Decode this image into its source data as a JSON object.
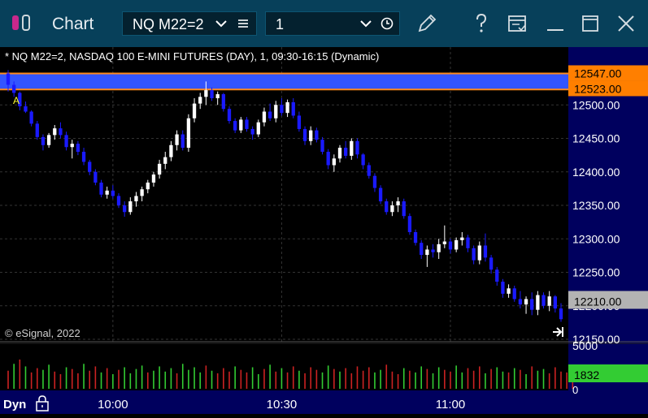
{
  "window": {
    "title": "Chart",
    "symbol": "NQ M22=2",
    "interval": "1",
    "icons": [
      "app-logo-icon",
      "chevron-down-icon",
      "menu-icon",
      "chevron-down-icon",
      "clock-icon",
      "pencil-icon",
      "help-icon",
      "template-icon",
      "minimize-icon",
      "maximize-icon",
      "close-icon"
    ]
  },
  "chart_header": "* NQ M22=2, NASDAQ 100 E-MINI FUTURES (DAY), 1, 09:30-16:15 (Dynamic)",
  "watermark": "© eSignal, 2022",
  "marker_label": "A",
  "bottom": {
    "mode": "Dyn",
    "lock_icon": "lock-icon",
    "goto_icon": "go-to-end-icon"
  },
  "colors": {
    "up": "#ffffff",
    "down": "#1a1aff",
    "band": "#3355ff",
    "band_border": "#ff8a1a",
    "price_tag": "#ff7f00",
    "last_tag": "#b3b3b3",
    "volume_tag": "#33cc33",
    "axis_bg": "#00005e"
  },
  "chart_data": {
    "type": "candlestick",
    "price_axis": {
      "ticks": [
        "12500.00",
        "12450.00",
        "12400.00",
        "12350.00",
        "12300.00",
        "12250.00",
        "12200.00",
        "12150.00"
      ],
      "ylim": [
        12150,
        12550
      ]
    },
    "time_axis": {
      "ticks": [
        "10:00",
        "10:30",
        "11:00"
      ]
    },
    "band": {
      "from": 12523,
      "to": 12547,
      "labels": [
        "12547.00",
        "12523.00"
      ]
    },
    "last_price_label": "12210.00",
    "volume_axis": {
      "max_label": "5000",
      "min_label": "0",
      "last_label": "1832",
      "ylim": [
        0,
        5000
      ]
    },
    "candles": [
      {
        "o": 12547,
        "h": 12552,
        "l": 12520,
        "c": 12530
      },
      {
        "o": 12530,
        "h": 12535,
        "l": 12512,
        "c": 12518
      },
      {
        "o": 12518,
        "h": 12520,
        "l": 12492,
        "c": 12498
      },
      {
        "o": 12498,
        "h": 12505,
        "l": 12488,
        "c": 12490
      },
      {
        "o": 12490,
        "h": 12492,
        "l": 12468,
        "c": 12472
      },
      {
        "o": 12472,
        "h": 12476,
        "l": 12448,
        "c": 12452
      },
      {
        "o": 12452,
        "h": 12456,
        "l": 12432,
        "c": 12440
      },
      {
        "o": 12440,
        "h": 12458,
        "l": 12436,
        "c": 12455
      },
      {
        "o": 12455,
        "h": 12470,
        "l": 12448,
        "c": 12465
      },
      {
        "o": 12465,
        "h": 12474,
        "l": 12450,
        "c": 12455
      },
      {
        "o": 12455,
        "h": 12460,
        "l": 12432,
        "c": 12437
      },
      {
        "o": 12437,
        "h": 12448,
        "l": 12420,
        "c": 12442
      },
      {
        "o": 12442,
        "h": 12446,
        "l": 12425,
        "c": 12430
      },
      {
        "o": 12430,
        "h": 12436,
        "l": 12410,
        "c": 12415
      },
      {
        "o": 12415,
        "h": 12418,
        "l": 12395,
        "c": 12400
      },
      {
        "o": 12400,
        "h": 12404,
        "l": 12380,
        "c": 12384
      },
      {
        "o": 12384,
        "h": 12388,
        "l": 12362,
        "c": 12366
      },
      {
        "o": 12366,
        "h": 12378,
        "l": 12360,
        "c": 12372
      },
      {
        "o": 12372,
        "h": 12380,
        "l": 12360,
        "c": 12364
      },
      {
        "o": 12364,
        "h": 12368,
        "l": 12346,
        "c": 12350
      },
      {
        "o": 12350,
        "h": 12356,
        "l": 12333,
        "c": 12340
      },
      {
        "o": 12340,
        "h": 12362,
        "l": 12336,
        "c": 12356
      },
      {
        "o": 12356,
        "h": 12370,
        "l": 12348,
        "c": 12364
      },
      {
        "o": 12364,
        "h": 12378,
        "l": 12356,
        "c": 12374
      },
      {
        "o": 12374,
        "h": 12388,
        "l": 12368,
        "c": 12384
      },
      {
        "o": 12384,
        "h": 12400,
        "l": 12378,
        "c": 12396
      },
      {
        "o": 12396,
        "h": 12418,
        "l": 12390,
        "c": 12412
      },
      {
        "o": 12412,
        "h": 12430,
        "l": 12404,
        "c": 12422
      },
      {
        "o": 12422,
        "h": 12446,
        "l": 12416,
        "c": 12440
      },
      {
        "o": 12440,
        "h": 12462,
        "l": 12432,
        "c": 12456
      },
      {
        "o": 12456,
        "h": 12462,
        "l": 12432,
        "c": 12436
      },
      {
        "o": 12436,
        "h": 12486,
        "l": 12430,
        "c": 12480
      },
      {
        "o": 12480,
        "h": 12510,
        "l": 12474,
        "c": 12502
      },
      {
        "o": 12502,
        "h": 12518,
        "l": 12494,
        "c": 12512
      },
      {
        "o": 12512,
        "h": 12535,
        "l": 12500,
        "c": 12522
      },
      {
        "o": 12522,
        "h": 12526,
        "l": 12506,
        "c": 12510
      },
      {
        "o": 12510,
        "h": 12520,
        "l": 12500,
        "c": 12516
      },
      {
        "o": 12516,
        "h": 12518,
        "l": 12490,
        "c": 12494
      },
      {
        "o": 12494,
        "h": 12498,
        "l": 12472,
        "c": 12476
      },
      {
        "o": 12476,
        "h": 12480,
        "l": 12458,
        "c": 12462
      },
      {
        "o": 12462,
        "h": 12482,
        "l": 12458,
        "c": 12478
      },
      {
        "o": 12478,
        "h": 12482,
        "l": 12460,
        "c": 12464
      },
      {
        "o": 12464,
        "h": 12468,
        "l": 12448,
        "c": 12456
      },
      {
        "o": 12456,
        "h": 12478,
        "l": 12452,
        "c": 12474
      },
      {
        "o": 12474,
        "h": 12496,
        "l": 12468,
        "c": 12490
      },
      {
        "o": 12490,
        "h": 12502,
        "l": 12476,
        "c": 12480
      },
      {
        "o": 12480,
        "h": 12506,
        "l": 12474,
        "c": 12500
      },
      {
        "o": 12500,
        "h": 12510,
        "l": 12484,
        "c": 12488
      },
      {
        "o": 12488,
        "h": 12508,
        "l": 12482,
        "c": 12504
      },
      {
        "o": 12504,
        "h": 12510,
        "l": 12480,
        "c": 12484
      },
      {
        "o": 12484,
        "h": 12490,
        "l": 12460,
        "c": 12464
      },
      {
        "o": 12464,
        "h": 12468,
        "l": 12440,
        "c": 12446
      },
      {
        "o": 12446,
        "h": 12468,
        "l": 12440,
        "c": 12462
      },
      {
        "o": 12462,
        "h": 12466,
        "l": 12444,
        "c": 12448
      },
      {
        "o": 12448,
        "h": 12452,
        "l": 12426,
        "c": 12430
      },
      {
        "o": 12430,
        "h": 12434,
        "l": 12404,
        "c": 12410
      },
      {
        "o": 12410,
        "h": 12426,
        "l": 12400,
        "c": 12420
      },
      {
        "o": 12420,
        "h": 12440,
        "l": 12414,
        "c": 12436
      },
      {
        "o": 12436,
        "h": 12446,
        "l": 12420,
        "c": 12424
      },
      {
        "o": 12424,
        "h": 12450,
        "l": 12418,
        "c": 12446
      },
      {
        "o": 12446,
        "h": 12450,
        "l": 12420,
        "c": 12426
      },
      {
        "o": 12426,
        "h": 12428,
        "l": 12404,
        "c": 12410
      },
      {
        "o": 12410,
        "h": 12414,
        "l": 12390,
        "c": 12394
      },
      {
        "o": 12394,
        "h": 12398,
        "l": 12370,
        "c": 12376
      },
      {
        "o": 12376,
        "h": 12380,
        "l": 12352,
        "c": 12356
      },
      {
        "o": 12356,
        "h": 12360,
        "l": 12336,
        "c": 12340
      },
      {
        "o": 12340,
        "h": 12356,
        "l": 12334,
        "c": 12350
      },
      {
        "o": 12350,
        "h": 12362,
        "l": 12340,
        "c": 12356
      },
      {
        "o": 12356,
        "h": 12360,
        "l": 12330,
        "c": 12334
      },
      {
        "o": 12334,
        "h": 12338,
        "l": 12306,
        "c": 12310
      },
      {
        "o": 12310,
        "h": 12314,
        "l": 12290,
        "c": 12294
      },
      {
        "o": 12294,
        "h": 12298,
        "l": 12270,
        "c": 12276
      },
      {
        "o": 12276,
        "h": 12290,
        "l": 12258,
        "c": 12284
      },
      {
        "o": 12284,
        "h": 12292,
        "l": 12272,
        "c": 12280
      },
      {
        "o": 12280,
        "h": 12300,
        "l": 12270,
        "c": 12292
      },
      {
        "o": 12292,
        "h": 12320,
        "l": 12286,
        "c": 12296
      },
      {
        "o": 12296,
        "h": 12300,
        "l": 12278,
        "c": 12284
      },
      {
        "o": 12284,
        "h": 12302,
        "l": 12280,
        "c": 12298
      },
      {
        "o": 12298,
        "h": 12310,
        "l": 12290,
        "c": 12302
      },
      {
        "o": 12302,
        "h": 12306,
        "l": 12280,
        "c": 12286
      },
      {
        "o": 12286,
        "h": 12290,
        "l": 12262,
        "c": 12268
      },
      {
        "o": 12268,
        "h": 12296,
        "l": 12262,
        "c": 12290
      },
      {
        "o": 12290,
        "h": 12308,
        "l": 12266,
        "c": 12272
      },
      {
        "o": 12272,
        "h": 12276,
        "l": 12248,
        "c": 12254
      },
      {
        "o": 12254,
        "h": 12258,
        "l": 12230,
        "c": 12236
      },
      {
        "o": 12236,
        "h": 12240,
        "l": 12212,
        "c": 12218
      },
      {
        "o": 12218,
        "h": 12232,
        "l": 12212,
        "c": 12226
      },
      {
        "o": 12226,
        "h": 12230,
        "l": 12206,
        "c": 12210
      },
      {
        "o": 12210,
        "h": 12222,
        "l": 12196,
        "c": 12202
      },
      {
        "o": 12202,
        "h": 12214,
        "l": 12188,
        "c": 12210
      },
      {
        "o": 12210,
        "h": 12220,
        "l": 12186,
        "c": 12194
      },
      {
        "o": 12194,
        "h": 12222,
        "l": 12186,
        "c": 12216
      },
      {
        "o": 12216,
        "h": 12220,
        "l": 12196,
        "c": 12200
      },
      {
        "o": 12200,
        "h": 12222,
        "l": 12192,
        "c": 12214
      },
      {
        "o": 12214,
        "h": 12216,
        "l": 12190,
        "c": 12196
      },
      {
        "o": 12196,
        "h": 12204,
        "l": 12176,
        "c": 12180
      }
    ],
    "volume": [
      2100,
      2900,
      3400,
      2600,
      1900,
      2400,
      2200,
      2800,
      2000,
      1700,
      2500,
      2300,
      1800,
      2900,
      2100,
      2600,
      1900,
      2400,
      1700,
      2200,
      2500,
      1800,
      2300,
      2700,
      1900,
      2100,
      2600,
      2000,
      2400,
      1800,
      2900,
      2200,
      2500,
      1900,
      2700,
      2100,
      1800,
      2400,
      2000,
      2600,
      2200,
      1900,
      2500,
      1700,
      2300,
      2800,
      2000,
      2400,
      1900,
      2600,
      2100,
      1800,
      2500,
      2200,
      1900,
      2700,
      2300,
      2000,
      2400,
      1800,
      2600,
      2100,
      2500,
      1900,
      2200,
      2800,
      2000,
      1700,
      2400,
      2100,
      1900,
      2600,
      2300,
      1800,
      2500,
      2200,
      2000,
      2700,
      1900,
      2400,
      2100,
      2600,
      1800,
      2300,
      2500,
      2000,
      1900,
      2400,
      2200,
      1700,
      2600,
      2100,
      2300,
      1800,
      2500,
      2000,
      1900,
      1832
    ],
    "volume_up_flags": [
      0,
      1,
      0,
      1,
      0,
      0,
      1,
      1,
      0,
      0,
      1,
      0,
      0,
      1,
      0,
      0,
      1,
      0,
      1,
      0,
      1,
      1,
      1,
      1,
      0,
      1,
      1,
      1,
      1,
      0,
      1,
      1,
      1,
      1,
      0,
      1,
      0,
      0,
      0,
      1,
      0,
      0,
      1,
      1,
      0,
      1,
      0,
      1,
      0,
      0,
      1,
      0,
      0,
      0,
      1,
      1,
      0,
      1,
      0,
      0,
      0,
      0,
      0,
      1,
      1,
      0,
      0,
      0,
      1,
      0,
      1,
      1,
      0,
      1,
      1,
      0,
      0,
      1,
      1,
      0,
      0,
      0,
      1,
      0,
      1,
      1,
      0,
      1,
      0,
      1,
      0,
      1,
      1,
      0,
      0,
      0,
      0,
      0
    ]
  }
}
